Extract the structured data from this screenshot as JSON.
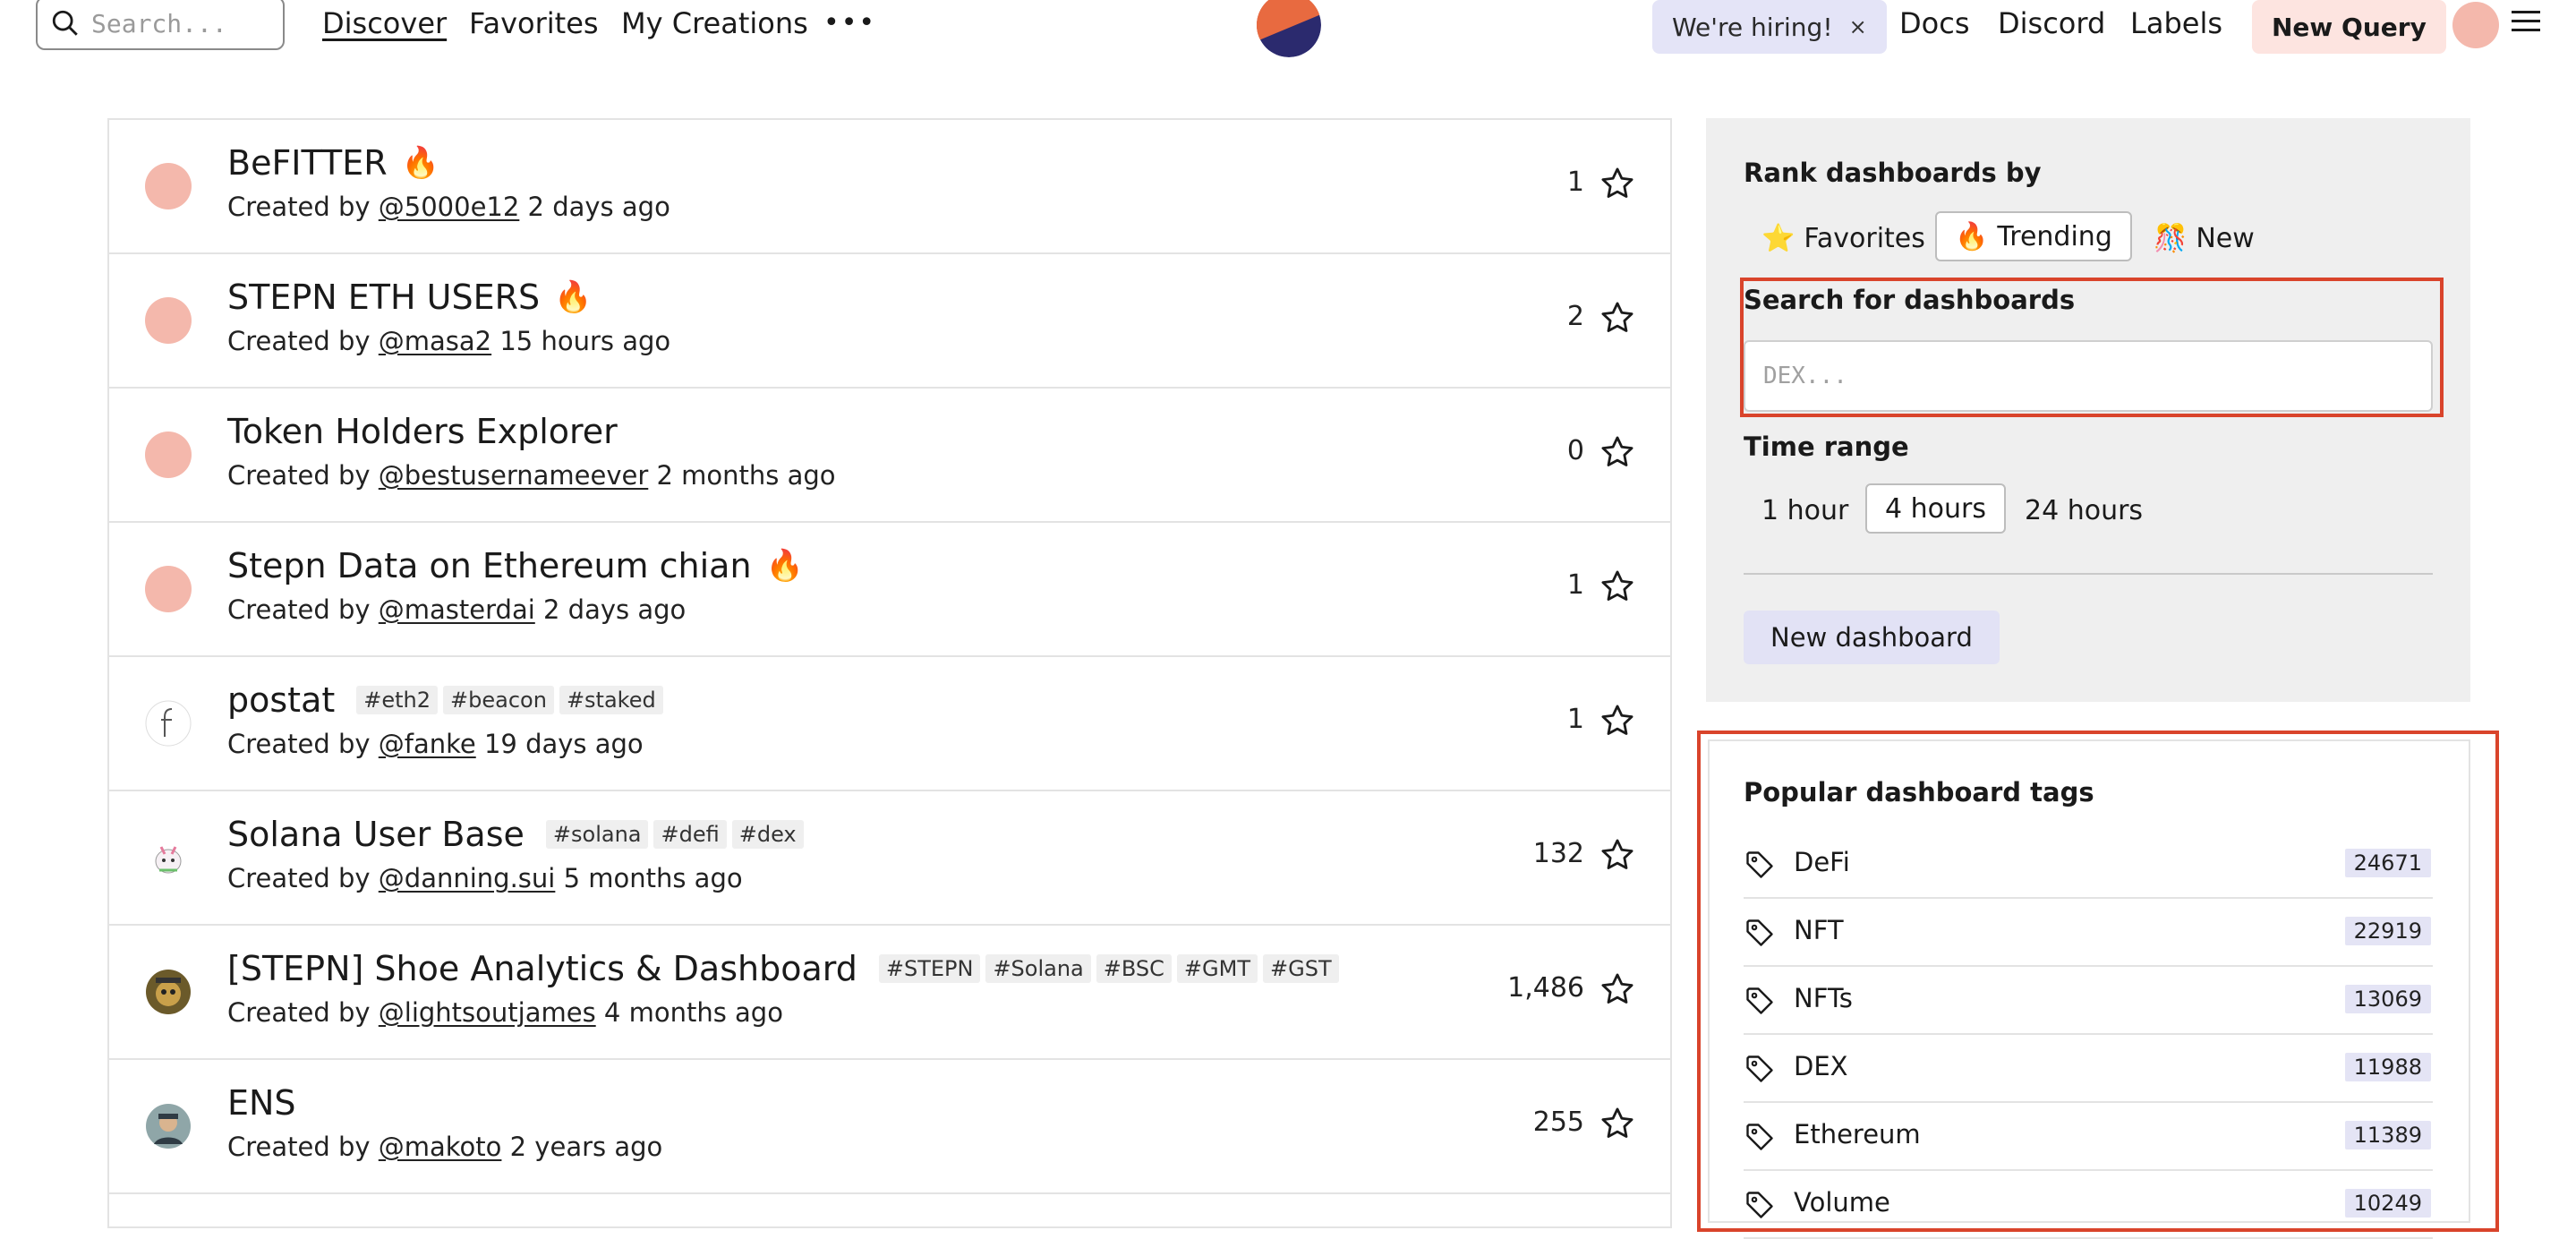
{
  "header": {
    "search_placeholder": "Search...",
    "nav": [
      "Discover",
      "Favorites",
      "My Creations"
    ],
    "more": "•••",
    "hiring": "We're hiring!",
    "hiring_close": "×",
    "links": [
      "Docs",
      "Discord",
      "Labels"
    ],
    "new_query": "New Query"
  },
  "dashboards": [
    {
      "title": "BeFITTER",
      "fire": true,
      "tags": [],
      "created_prefix": "Created by",
      "author": "@5000e12",
      "when": "2 days ago",
      "stars": "1",
      "avatar": "pink"
    },
    {
      "title": "STEPN ETH USERS",
      "fire": true,
      "tags": [],
      "created_prefix": "Created by",
      "author": "@masa2",
      "when": "15 hours ago",
      "stars": "2",
      "avatar": "pink"
    },
    {
      "title": "Token Holders Explorer",
      "fire": false,
      "tags": [],
      "created_prefix": "Created by",
      "author": "@bestusernameever",
      "when": "2 months ago",
      "stars": "0",
      "avatar": "pink"
    },
    {
      "title": "Stepn Data on Ethereum chian",
      "fire": true,
      "tags": [],
      "created_prefix": "Created by",
      "author": "@masterdai",
      "when": "2 days ago",
      "stars": "1",
      "avatar": "pink"
    },
    {
      "title": "postat",
      "fire": false,
      "tags": [
        "#eth2",
        "#beacon",
        "#staked"
      ],
      "created_prefix": "Created by",
      "author": "@fanke",
      "when": "19 days ago",
      "stars": "1",
      "avatar": "sketch"
    },
    {
      "title": "Solana User Base",
      "fire": false,
      "tags": [
        "#solana",
        "#defi",
        "#dex"
      ],
      "created_prefix": "Created by",
      "author": "@danning.sui",
      "when": "5 months ago",
      "stars": "132",
      "avatar": "unicorn"
    },
    {
      "title": "[STEPN] Shoe Analytics & Dashboard",
      "fire": false,
      "tags": [
        "#STEPN",
        "#Solana",
        "#BSC",
        "#GMT",
        "#GST"
      ],
      "created_prefix": "Created by",
      "author": "@lightsoutjames",
      "when": "4 months ago",
      "stars": "1,486",
      "avatar": "ape"
    },
    {
      "title": "ENS",
      "fire": false,
      "tags": [],
      "created_prefix": "Created by",
      "author": "@makoto",
      "when": "2 years ago",
      "stars": "255",
      "avatar": "photo"
    }
  ],
  "sidebar": {
    "rank_label": "Rank dashboards by",
    "rank_options": [
      {
        "emoji": "⭐",
        "label": "Favorites",
        "selected": false
      },
      {
        "emoji": "🔥",
        "label": "Trending",
        "selected": true
      },
      {
        "emoji": "🎊",
        "label": "New",
        "selected": false
      }
    ],
    "search_label": "Search for dashboards",
    "search_placeholder": "DEX...",
    "time_label": "Time range",
    "time_options": [
      {
        "label": "1 hour",
        "selected": false
      },
      {
        "label": "4 hours",
        "selected": true
      },
      {
        "label": "24 hours",
        "selected": false
      }
    ],
    "new_dashboard": "New dashboard"
  },
  "popular_tags": {
    "label": "Popular dashboard tags",
    "items": [
      {
        "name": "DeFi",
        "count": "24671"
      },
      {
        "name": "NFT",
        "count": "22919"
      },
      {
        "name": "NFTs",
        "count": "13069"
      },
      {
        "name": "DEX",
        "count": "11988"
      },
      {
        "name": "Ethereum",
        "count": "11389"
      },
      {
        "name": "Volume",
        "count": "10249"
      }
    ]
  },
  "colors": {
    "highlight": "#d9442b",
    "hiring_bg": "#e4e4f7",
    "new_query_bg": "#fde4e0",
    "avatar_pink": "#f4b8ac"
  }
}
